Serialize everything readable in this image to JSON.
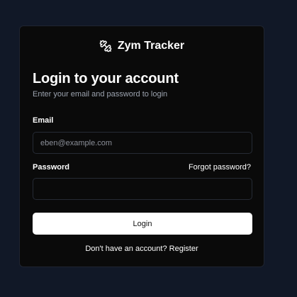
{
  "app": {
    "name": "Zym Tracker",
    "logo_icon": "dumbbell-icon"
  },
  "login": {
    "title": "Login to your account",
    "subtitle": "Enter your email and password to login",
    "email_label": "Email",
    "email_placeholder": "eben@example.com",
    "email_value": "",
    "password_label": "Password",
    "password_value": "",
    "forgot_password": "Forgot password?",
    "submit_label": "Login",
    "register_prompt": "Don't have an account?",
    "register_link": "Register"
  },
  "colors": {
    "page_background": "#111827",
    "card_background": "#0a0a0a",
    "button_background": "#ffffff"
  }
}
